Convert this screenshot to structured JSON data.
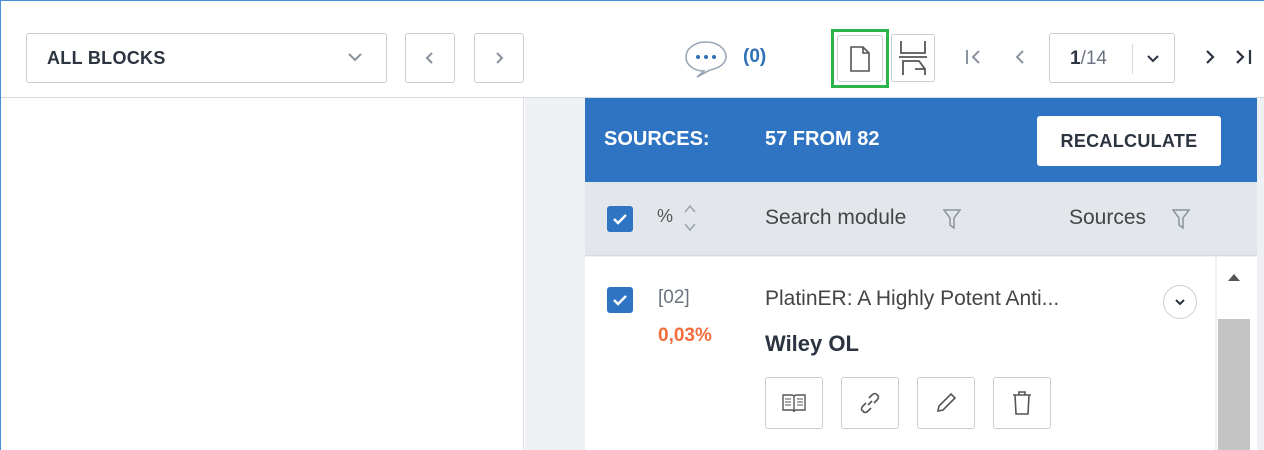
{
  "toolbar": {
    "blocks_select": "ALL BLOCKS",
    "comments_count": "(0)",
    "page": {
      "current": "1",
      "total": "/14"
    }
  },
  "sources": {
    "header_label": "SOURCES:",
    "header_value": "57 FROM 82",
    "recalculate_label": "RECALCULATE",
    "columns": {
      "percent": "%",
      "search_module": "Search module",
      "sources": "Sources"
    },
    "rows": [
      {
        "index": "[02]",
        "percent": "0,03%",
        "title": "PlatinER: A Highly Potent Anti...",
        "database": "Wiley OL",
        "actions": [
          "book-icon",
          "link-icon",
          "pencil-icon",
          "trash-icon"
        ]
      }
    ]
  },
  "colors": {
    "accent": "#2e74c2",
    "highlight": "#2cb34a",
    "percent": "#f26d3d"
  }
}
